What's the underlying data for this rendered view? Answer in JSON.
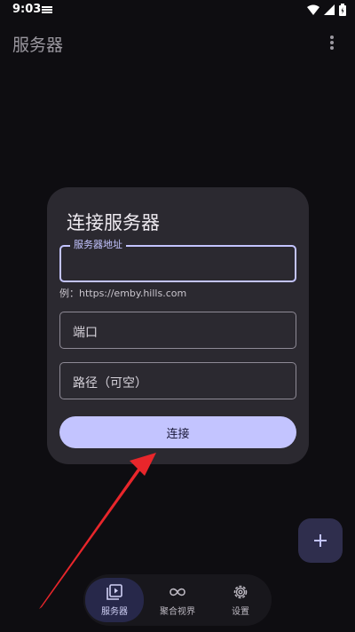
{
  "status_bar": {
    "time": "9:03"
  },
  "app_bar": {
    "title": "服务器"
  },
  "dialog": {
    "title": "连接服务器",
    "server_address": {
      "label": "服务器地址",
      "value": ""
    },
    "helper_text": "例：https://emby.hills.com",
    "port": {
      "placeholder": "端口"
    },
    "path": {
      "placeholder": "路径（可空）"
    },
    "connect_label": "连接"
  },
  "fab": {
    "icon": "plus-icon"
  },
  "bottom_nav": {
    "items": [
      {
        "label": "服务器",
        "icon": "server-library-icon",
        "active": true
      },
      {
        "label": "聚合视界",
        "icon": "infinity-icon",
        "active": false
      },
      {
        "label": "设置",
        "icon": "gear-icon",
        "active": false
      }
    ]
  },
  "colors": {
    "background": "#0e0d11",
    "dialog": "#2b2930",
    "accent": "#c3c4ff",
    "annotation": "#e8262b"
  }
}
